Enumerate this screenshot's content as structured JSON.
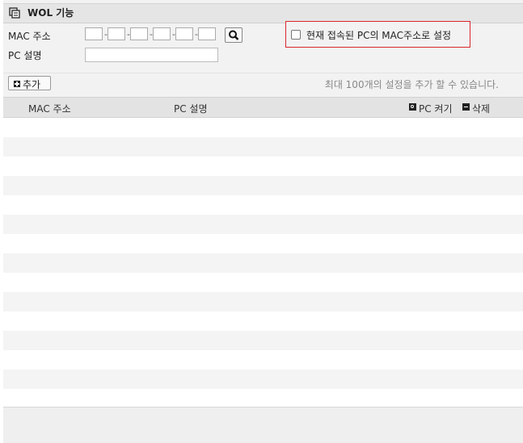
{
  "panel": {
    "title": "WOL 기능",
    "title_icon": "copy-window-icon"
  },
  "form": {
    "mac_label": "MAC 주소",
    "pc_desc_label": "PC 설명",
    "mac_octets": [
      "",
      "",
      "",
      "",
      "",
      ""
    ],
    "mac_separator": "-",
    "pc_desc_value": "",
    "search_icon": "magnifier-icon",
    "use_current_pc_label": "현재 접속된 PC의 MAC주소로 설정",
    "use_current_pc_checked": false
  },
  "toolbar": {
    "add_label": "추가",
    "limit_text": "최대 100개의 설정을 추가 할 수 있습니다."
  },
  "table": {
    "columns": {
      "mac": "MAC 주소",
      "desc": "PC 설명",
      "power_on": "PC 켜기",
      "delete": "삭제"
    },
    "rows": []
  },
  "colors": {
    "highlight_border": "#d9262a",
    "header_bg": "#e3e3e3",
    "panel_bg": "#f2f2f2"
  }
}
